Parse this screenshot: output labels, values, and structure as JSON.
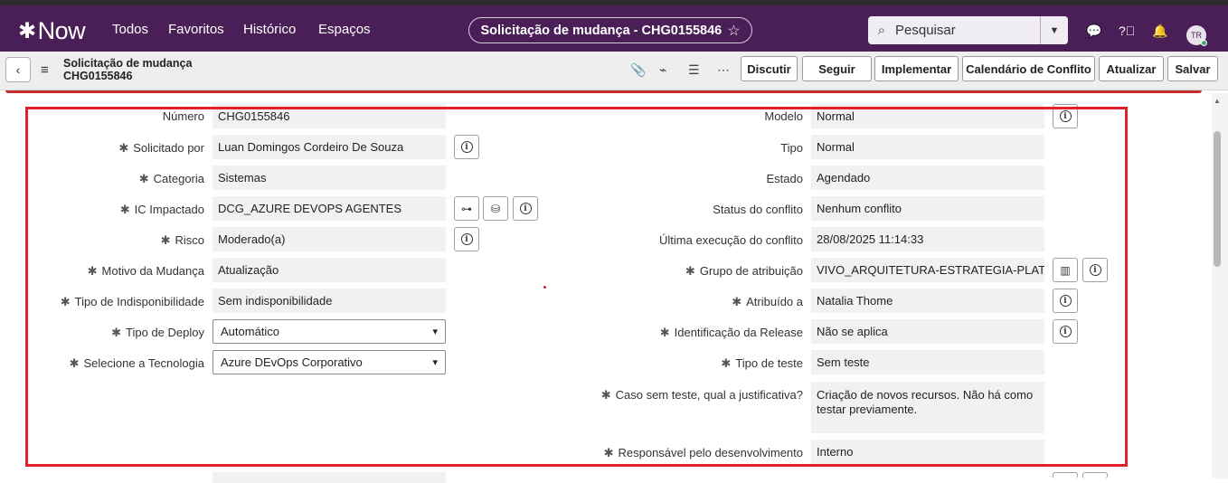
{
  "nav": {
    "logo": "Now",
    "items": [
      "Todos",
      "Favoritos",
      "Histórico",
      "Espaços"
    ],
    "record_title": "Solicitação de mudança - CHG0155846",
    "search_placeholder": "Pesquisar",
    "avatar_initials": "TR"
  },
  "toolbar": {
    "breadcrumb_line1": "Solicitação de mudança",
    "breadcrumb_line2": "CHG0155846",
    "buttons": [
      "Discutir",
      "Seguir",
      "Implementar",
      "Calendário de Conflito",
      "Atualizar",
      "Salvar"
    ]
  },
  "form": {
    "left": [
      {
        "label": "Número",
        "value": "CHG0155846",
        "required": false
      },
      {
        "label": "Solicitado por",
        "value": "Luan Domingos Cordeiro De Souza",
        "required": true
      },
      {
        "label": "Categoria",
        "value": "Sistemas",
        "required": true
      },
      {
        "label": "IC Impactado",
        "value": "DCG_AZURE DEVOPS AGENTES",
        "required": true
      },
      {
        "label": "Risco",
        "value": "Moderado(a)",
        "required": true
      },
      {
        "label": "Motivo da Mudança",
        "value": "Atualização",
        "required": true
      },
      {
        "label": "Tipo de Indisponibilidade",
        "value": "Sem indisponibilidade",
        "required": true
      },
      {
        "label": "Tipo de Deploy",
        "value": "Automático",
        "required": true
      },
      {
        "label": "Selecione a Tecnologia",
        "value": "Azure DEvOps Corporativo",
        "required": true
      }
    ],
    "right": [
      {
        "label": "Modelo",
        "value": "Normal",
        "required": false
      },
      {
        "label": "Tipo",
        "value": "Normal",
        "required": false
      },
      {
        "label": "Estado",
        "value": "Agendado",
        "required": false
      },
      {
        "label": "Status do conflito",
        "value": "Nenhum conflito",
        "required": false
      },
      {
        "label": "Última execução do conflito",
        "value": "28/08/2025 11:14:33",
        "required": false
      },
      {
        "label": "Grupo de atribuição",
        "value": "VIVO_ARQUITETURA-ESTRATEGIA-PLATA",
        "required": true
      },
      {
        "label": "Atribuído a",
        "value": "Natalia Thome",
        "required": true
      },
      {
        "label": "Identificação da Release",
        "value": "Não se aplica",
        "required": true
      },
      {
        "label": "Tipo de teste",
        "value": "Sem teste",
        "required": true
      },
      {
        "label": "Caso sem teste, qual a justificativa?",
        "value": "Criação de novos recursos. Não há como testar previamente.",
        "required": true
      },
      {
        "label": "Responsável pelo desenvolvimento",
        "value": "Interno",
        "required": true
      }
    ]
  },
  "colors": {
    "nav_bg": "#4a1f57",
    "highlight": "#e0202a",
    "field_bg": "#f1f1f1"
  }
}
